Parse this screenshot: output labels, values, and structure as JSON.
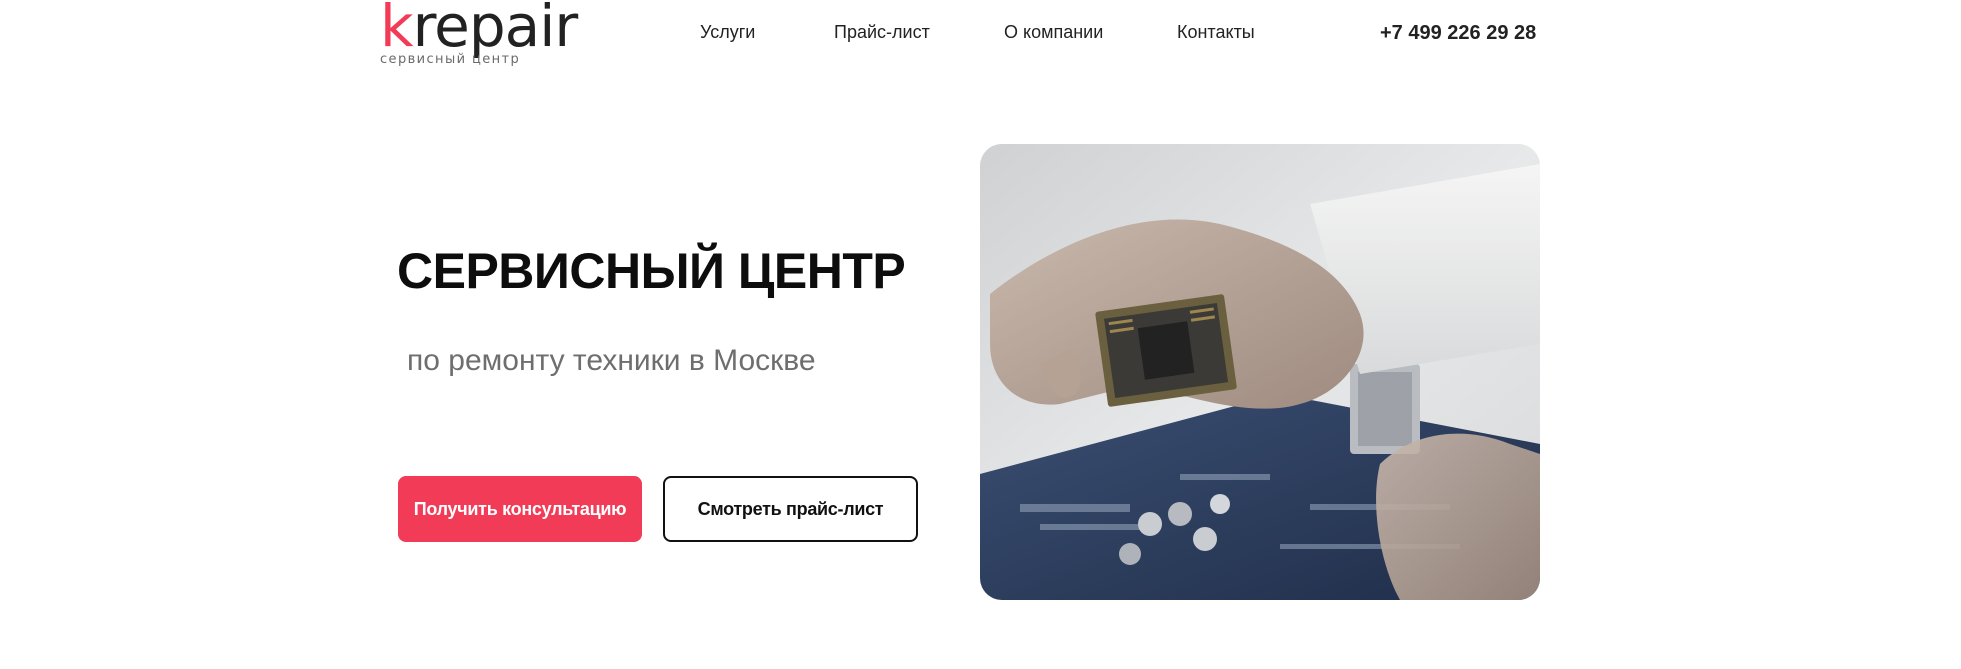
{
  "brand": {
    "logo_k": "k",
    "logo_rest": "repair",
    "logo_sub": "сервисный центр",
    "accent_color": "#f23b57"
  },
  "nav": {
    "items": [
      {
        "label": "Услуги"
      },
      {
        "label": "Прайс-лист"
      },
      {
        "label": "О компании"
      },
      {
        "label": "Контакты"
      }
    ]
  },
  "header": {
    "phone": "+7 499 226 29 28"
  },
  "hero": {
    "title": "СЕРВИСНЫЙ ЦЕНТР",
    "subtitle": "по ремонту техники в Москве",
    "primary_button": "Получить консультацию",
    "secondary_button": "Смотреть прайс-лист",
    "image_icon": "cpu-repair-photo"
  }
}
